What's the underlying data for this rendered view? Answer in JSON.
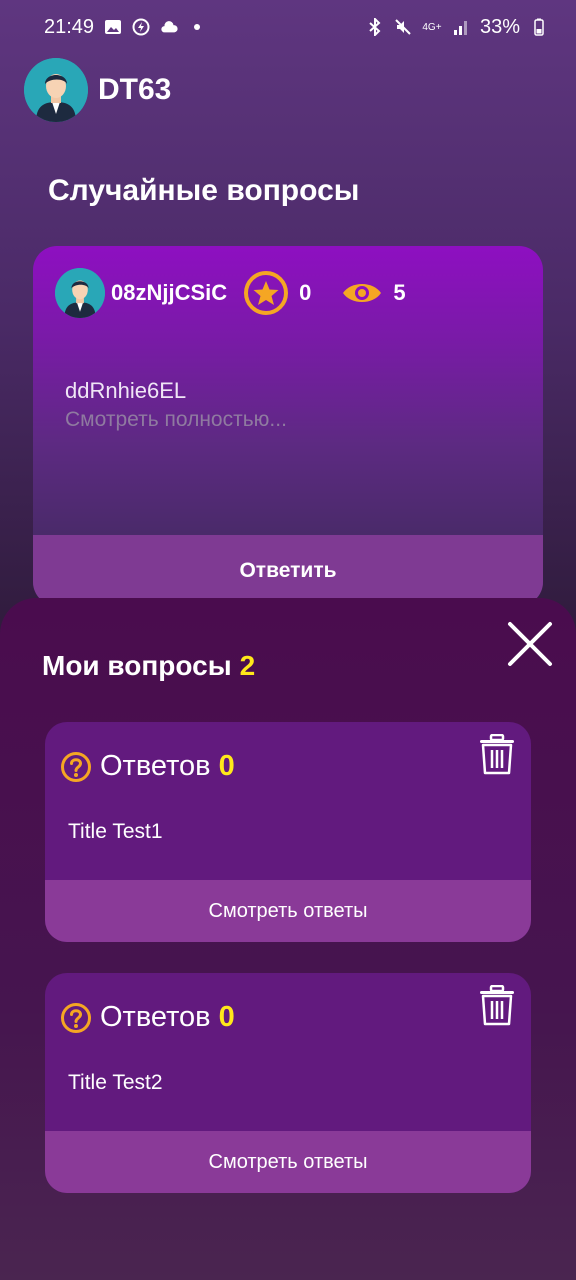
{
  "status_bar": {
    "time": "21:49",
    "battery": "33%",
    "icons": [
      "gallery-icon",
      "data-saver-icon",
      "cloud-icon",
      "bluetooth-icon",
      "mute-icon",
      "4g-icon",
      "signal-icon",
      "battery-icon"
    ]
  },
  "header": {
    "username": "DT63"
  },
  "random_section": {
    "title": "Случайные вопросы",
    "card": {
      "author": "08zNjjCSiC",
      "stars": "0",
      "views": "5",
      "question_title": "ddRnhie6EL",
      "more_link": "Смотреть полностью...",
      "answer_button": "Ответить"
    }
  },
  "my_questions": {
    "title": "Мои вопросы",
    "count": "2",
    "items": [
      {
        "answers_label": "Ответов",
        "answers_count": "0",
        "title": "Title Test1",
        "view_button": "Смотреть ответы"
      },
      {
        "answers_label": "Ответов",
        "answers_count": "0",
        "title": "Title Test2",
        "view_button": "Смотреть ответы"
      }
    ]
  },
  "colors": {
    "accent_yellow": "#ffe81a",
    "icon_orange": "#f5a623",
    "card_purple": "#621a7e",
    "button_purple": "#8a3a98"
  }
}
